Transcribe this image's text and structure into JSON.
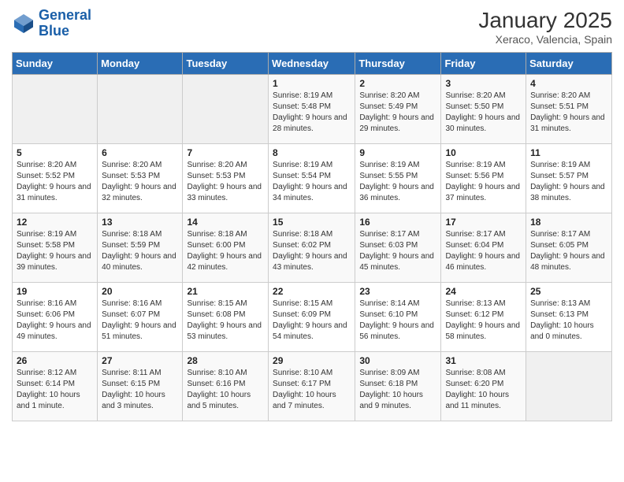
{
  "logo": {
    "line1": "General",
    "line2": "Blue"
  },
  "title": {
    "month_year": "January 2025",
    "location": "Xeraco, Valencia, Spain"
  },
  "weekdays": [
    "Sunday",
    "Monday",
    "Tuesday",
    "Wednesday",
    "Thursday",
    "Friday",
    "Saturday"
  ],
  "weeks": [
    [
      {
        "day": "",
        "info": ""
      },
      {
        "day": "",
        "info": ""
      },
      {
        "day": "",
        "info": ""
      },
      {
        "day": "1",
        "info": "Sunrise: 8:19 AM\nSunset: 5:48 PM\nDaylight: 9 hours and 28 minutes."
      },
      {
        "day": "2",
        "info": "Sunrise: 8:20 AM\nSunset: 5:49 PM\nDaylight: 9 hours and 29 minutes."
      },
      {
        "day": "3",
        "info": "Sunrise: 8:20 AM\nSunset: 5:50 PM\nDaylight: 9 hours and 30 minutes."
      },
      {
        "day": "4",
        "info": "Sunrise: 8:20 AM\nSunset: 5:51 PM\nDaylight: 9 hours and 31 minutes."
      }
    ],
    [
      {
        "day": "5",
        "info": "Sunrise: 8:20 AM\nSunset: 5:52 PM\nDaylight: 9 hours and 31 minutes."
      },
      {
        "day": "6",
        "info": "Sunrise: 8:20 AM\nSunset: 5:53 PM\nDaylight: 9 hours and 32 minutes."
      },
      {
        "day": "7",
        "info": "Sunrise: 8:20 AM\nSunset: 5:53 PM\nDaylight: 9 hours and 33 minutes."
      },
      {
        "day": "8",
        "info": "Sunrise: 8:19 AM\nSunset: 5:54 PM\nDaylight: 9 hours and 34 minutes."
      },
      {
        "day": "9",
        "info": "Sunrise: 8:19 AM\nSunset: 5:55 PM\nDaylight: 9 hours and 36 minutes."
      },
      {
        "day": "10",
        "info": "Sunrise: 8:19 AM\nSunset: 5:56 PM\nDaylight: 9 hours and 37 minutes."
      },
      {
        "day": "11",
        "info": "Sunrise: 8:19 AM\nSunset: 5:57 PM\nDaylight: 9 hours and 38 minutes."
      }
    ],
    [
      {
        "day": "12",
        "info": "Sunrise: 8:19 AM\nSunset: 5:58 PM\nDaylight: 9 hours and 39 minutes."
      },
      {
        "day": "13",
        "info": "Sunrise: 8:18 AM\nSunset: 5:59 PM\nDaylight: 9 hours and 40 minutes."
      },
      {
        "day": "14",
        "info": "Sunrise: 8:18 AM\nSunset: 6:00 PM\nDaylight: 9 hours and 42 minutes."
      },
      {
        "day": "15",
        "info": "Sunrise: 8:18 AM\nSunset: 6:02 PM\nDaylight: 9 hours and 43 minutes."
      },
      {
        "day": "16",
        "info": "Sunrise: 8:17 AM\nSunset: 6:03 PM\nDaylight: 9 hours and 45 minutes."
      },
      {
        "day": "17",
        "info": "Sunrise: 8:17 AM\nSunset: 6:04 PM\nDaylight: 9 hours and 46 minutes."
      },
      {
        "day": "18",
        "info": "Sunrise: 8:17 AM\nSunset: 6:05 PM\nDaylight: 9 hours and 48 minutes."
      }
    ],
    [
      {
        "day": "19",
        "info": "Sunrise: 8:16 AM\nSunset: 6:06 PM\nDaylight: 9 hours and 49 minutes."
      },
      {
        "day": "20",
        "info": "Sunrise: 8:16 AM\nSunset: 6:07 PM\nDaylight: 9 hours and 51 minutes."
      },
      {
        "day": "21",
        "info": "Sunrise: 8:15 AM\nSunset: 6:08 PM\nDaylight: 9 hours and 53 minutes."
      },
      {
        "day": "22",
        "info": "Sunrise: 8:15 AM\nSunset: 6:09 PM\nDaylight: 9 hours and 54 minutes."
      },
      {
        "day": "23",
        "info": "Sunrise: 8:14 AM\nSunset: 6:10 PM\nDaylight: 9 hours and 56 minutes."
      },
      {
        "day": "24",
        "info": "Sunrise: 8:13 AM\nSunset: 6:12 PM\nDaylight: 9 hours and 58 minutes."
      },
      {
        "day": "25",
        "info": "Sunrise: 8:13 AM\nSunset: 6:13 PM\nDaylight: 10 hours and 0 minutes."
      }
    ],
    [
      {
        "day": "26",
        "info": "Sunrise: 8:12 AM\nSunset: 6:14 PM\nDaylight: 10 hours and 1 minute."
      },
      {
        "day": "27",
        "info": "Sunrise: 8:11 AM\nSunset: 6:15 PM\nDaylight: 10 hours and 3 minutes."
      },
      {
        "day": "28",
        "info": "Sunrise: 8:10 AM\nSunset: 6:16 PM\nDaylight: 10 hours and 5 minutes."
      },
      {
        "day": "29",
        "info": "Sunrise: 8:10 AM\nSunset: 6:17 PM\nDaylight: 10 hours and 7 minutes."
      },
      {
        "day": "30",
        "info": "Sunrise: 8:09 AM\nSunset: 6:18 PM\nDaylight: 10 hours and 9 minutes."
      },
      {
        "day": "31",
        "info": "Sunrise: 8:08 AM\nSunset: 6:20 PM\nDaylight: 10 hours and 11 minutes."
      },
      {
        "day": "",
        "info": ""
      }
    ]
  ]
}
